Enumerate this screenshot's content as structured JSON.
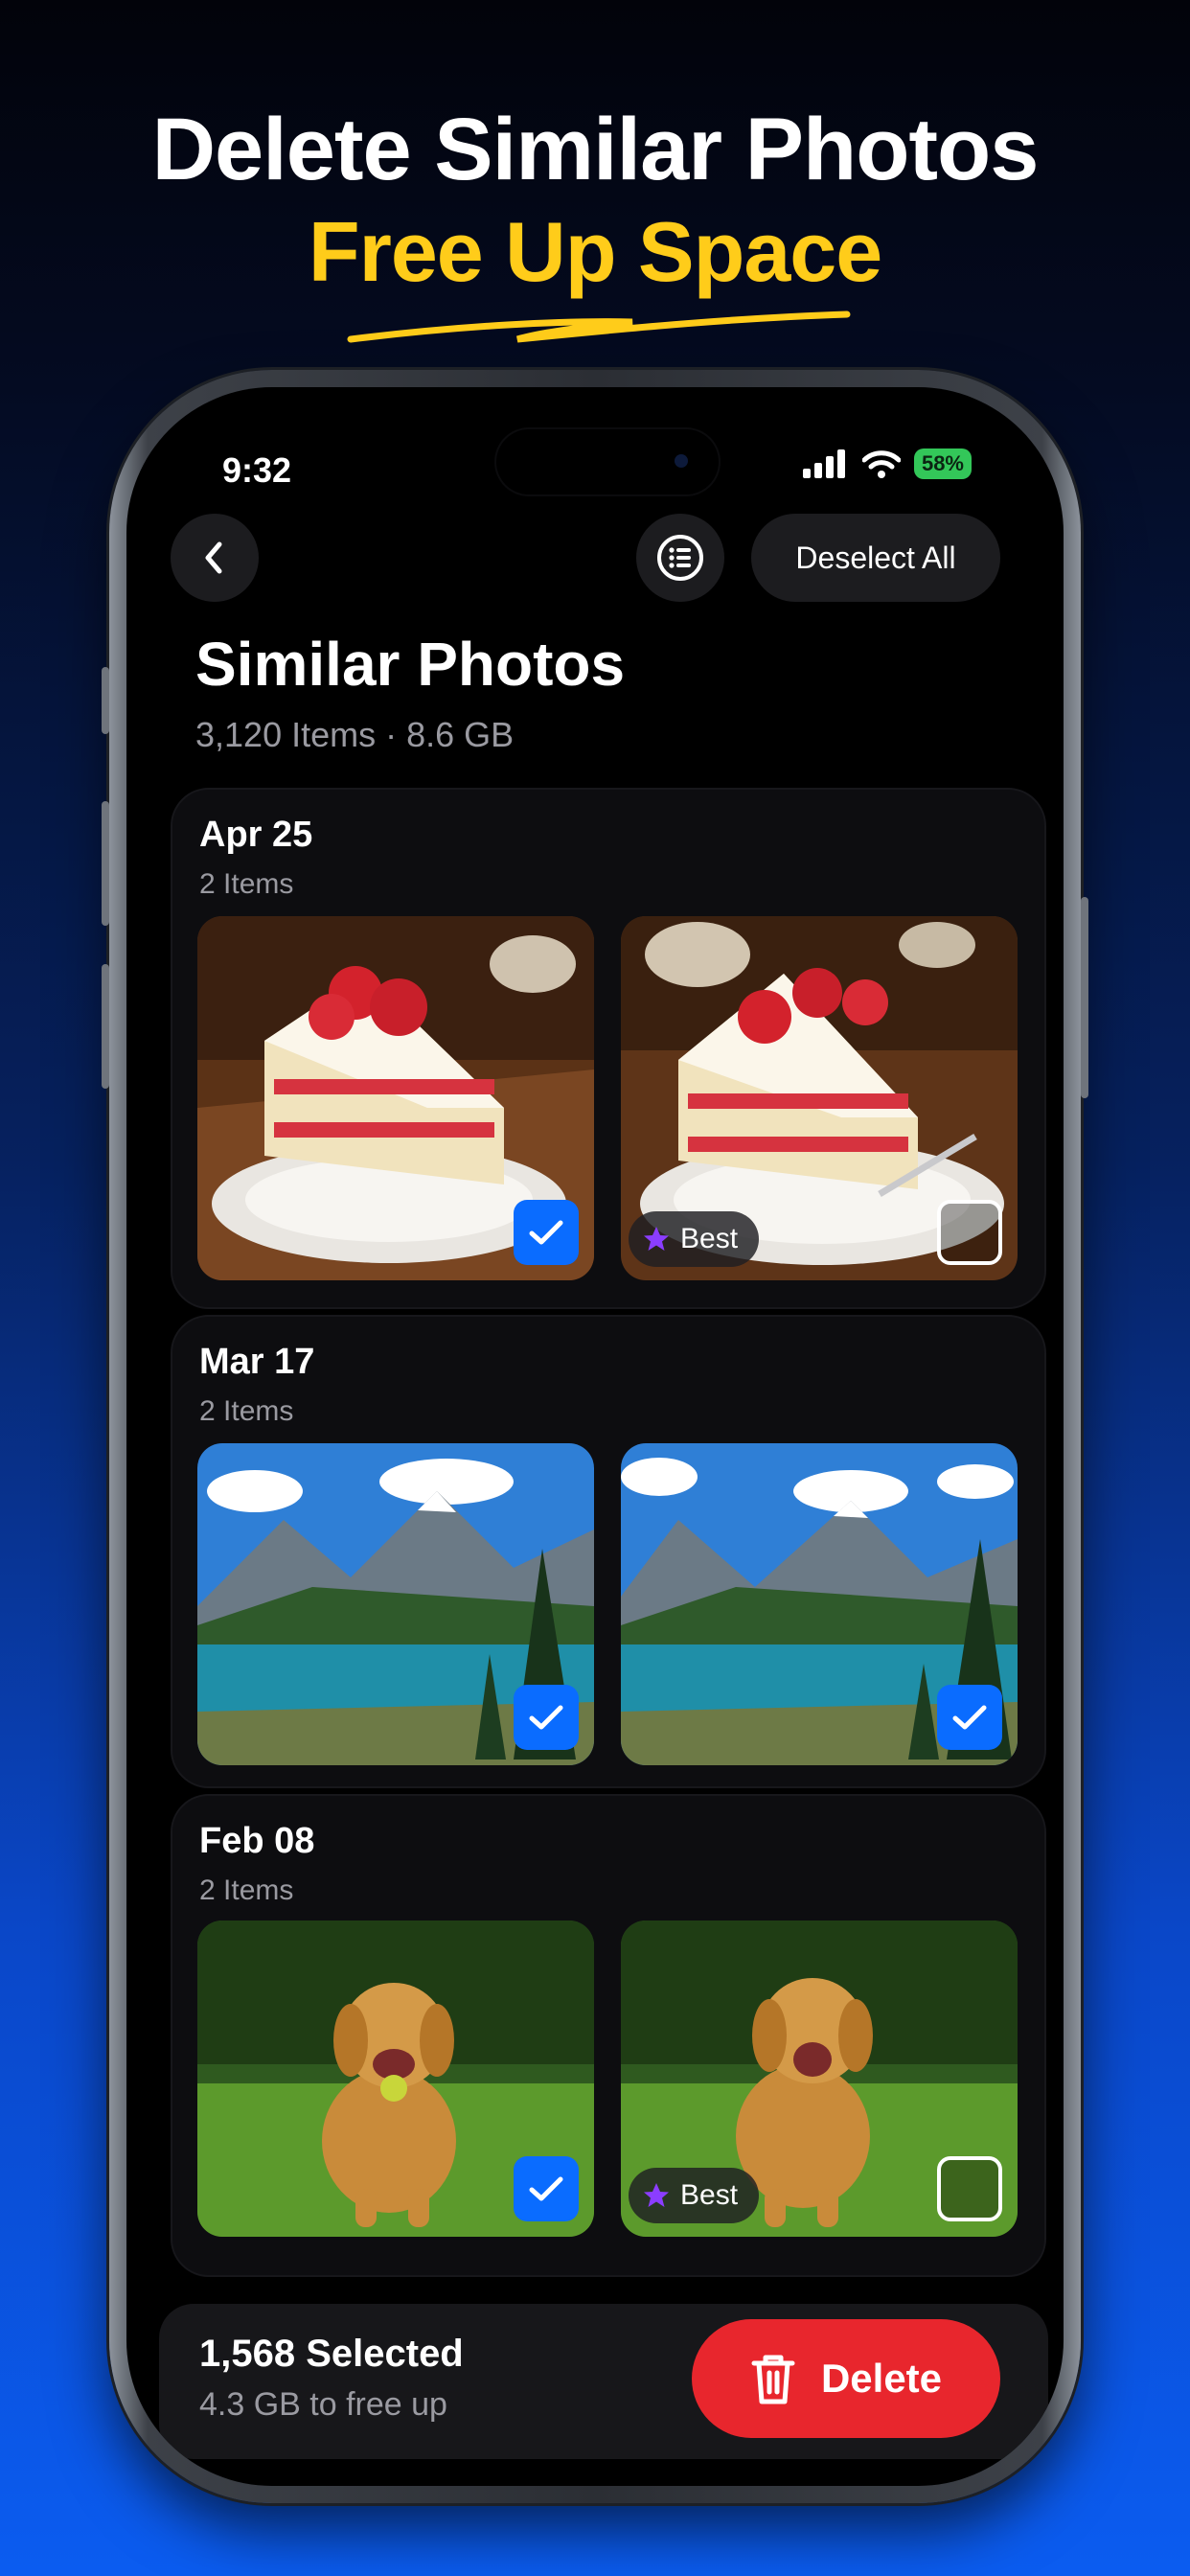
{
  "headline": {
    "line1": "Delete Similar Photos",
    "line2": "Free Up Space"
  },
  "colors": {
    "accent": "#ffcc1a",
    "check": "#0a6cff",
    "delete": "#e8262d",
    "best_star": "#8b3dff"
  },
  "status_bar": {
    "time": "9:32",
    "battery": "58%"
  },
  "nav": {
    "deselect_label": "Deselect All",
    "back_icon": "chevron-left-icon",
    "list_icon": "list-icon"
  },
  "page": {
    "title": "Similar Photos",
    "subtitle": "3,120 Items · 8.6 GB"
  },
  "groups": [
    {
      "date": "Apr 25",
      "count": "2 Items",
      "photos": [
        {
          "subject": "cake",
          "selected": true,
          "best": false
        },
        {
          "subject": "cake",
          "selected": false,
          "best": true
        }
      ]
    },
    {
      "date": "Mar 17",
      "count": "2 Items",
      "photos": [
        {
          "subject": "mountain-lake",
          "selected": true,
          "best": false
        },
        {
          "subject": "mountain-lake",
          "selected": true,
          "best": false
        }
      ]
    },
    {
      "date": "Feb 08",
      "count": "2 Items",
      "photos": [
        {
          "subject": "dog",
          "selected": true,
          "best": false
        },
        {
          "subject": "dog",
          "selected": false,
          "best": true
        }
      ]
    }
  ],
  "best_label": "Best",
  "footer": {
    "selected": "1,568 Selected",
    "free_up": "4.3 GB to free up",
    "delete_label": "Delete"
  }
}
